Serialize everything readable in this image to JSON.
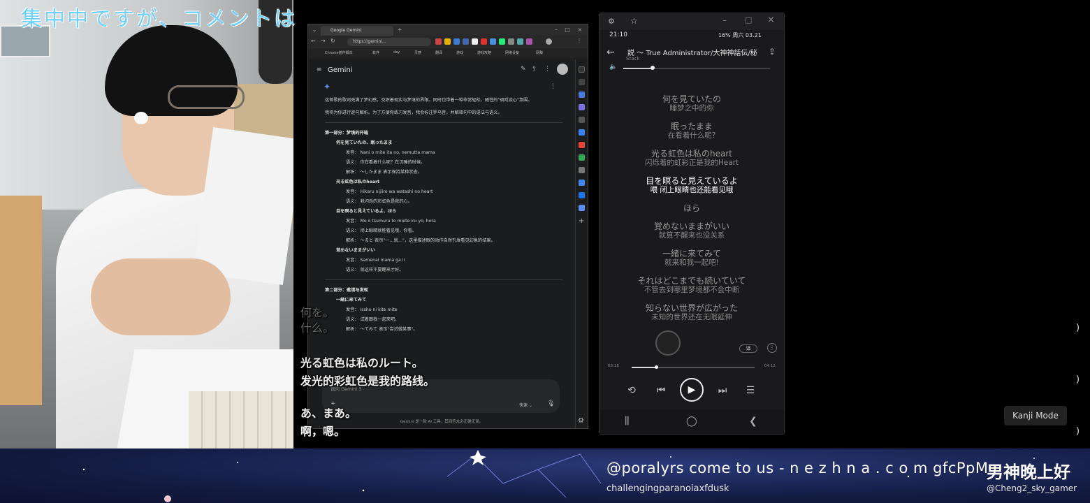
{
  "stream": {
    "title_overlay": "集中中ですが、コメントは",
    "overlay_lines": [
      {
        "text": "何を。",
        "style": "dim"
      },
      {
        "text": "什么。",
        "style": "dim"
      },
      {
        "text": "光る虹色は私のルート。",
        "style": "br"
      },
      {
        "text": "发光的彩虹色是我的路线。",
        "style": "br"
      },
      {
        "text": "あ、まあ。",
        "style": "br"
      },
      {
        "text": "啊，嗯。",
        "style": "br"
      }
    ],
    "ticker": "@poralyrs come to us - n e z h n a . c o m gfcPpM",
    "ticker_sub": "challengingparanoiaxfdusk",
    "greeting": "男神晚上好",
    "handle": "@Cheng2_sky_gamer",
    "kanji_mode": "Kanji Mode"
  },
  "browser": {
    "tab_title": "Google Gemini",
    "url": "https://gemini...",
    "bookmarks": [
      "Chrome插件脚本",
      "软件",
      "day",
      "灵感",
      "翻译",
      "游戏",
      "游戏攻略",
      "网络设备",
      "网赚"
    ],
    "app_title": "Gemini",
    "content": {
      "intro": "这首歌的歌词充满了梦幻感，交织着现实与梦境的界限。同时也带着一种非常轻松、随性的\"调戏谈心\"氛围。",
      "intro2": "我将为你进行逐句解析。为了方便你练习发音，我会标注罗马音，并解释句中的语法与语义。",
      "section1": "第一部分：梦境的开端",
      "items1": [
        {
          "head": "何を見ていたの、眠ったまま",
          "lines": [
            "发音： Nani o mite ita no, nemutta mama",
            "语义： 你在看着什么呢？在沉睡的时候。",
            "解析： 〜したまま 表示保持某种状态。"
          ]
        },
        {
          "head": "光る虹色は私のheart",
          "lines": [
            "发音： Hikaru nijiiro wa watashi no heart",
            "语义： 我闪烁的彩虹色是我的心。"
          ]
        },
        {
          "head": "目を瞑ると見えているよ、ほら",
          "lines": [
            "发音： Me o tsumuru to miete iru yo, hora",
            "语义： 闭上眼睛就能看见哦，你看。",
            "解析： 〜ると 表示\"一…就…\"，这里描述眼的动作自然引发看见幻象的结果。"
          ]
        },
        {
          "head": "覚めないままがいい",
          "lines": [
            "发音： Samenai mama ga ii",
            "语义： 就这样不要醒来才好。"
          ]
        }
      ],
      "section2": "第二部分：邀请与发现",
      "items2": [
        {
          "head": "一緒に来てみて",
          "lines": [
            "发音： Issho ni kite mite",
            "语义： 试着跟我一起来吧。",
            "解析： 〜てみて 表示\"尝试做某事\"。"
          ]
        }
      ]
    },
    "chat_placeholder": "询问 Gemini 3",
    "chat_mode": "快速",
    "disclaimer": "Gemini 是一款 AI 工具，其回答未必正确无误。"
  },
  "player": {
    "status_time": "21:10",
    "status_right": "16%  周六 03.21",
    "title": "説 ～ True Administrator/大神神話伝/秘",
    "artist": "Stack",
    "volume": 0.2,
    "lyrics": [
      {
        "jp": "何を見ていたの",
        "cn": "睡梦之中的你",
        "current": false
      },
      {
        "jp": "眠ったまま",
        "cn": "在看着什么呢?",
        "current": false
      },
      {
        "jp": "光る虹色は私のheart",
        "cn": "闪烁着的虹彩正是我的Heart",
        "current": false
      },
      {
        "jp": "目を瞑ると見えているよ",
        "cn": "喂 闭上眼睛也还能看见哦",
        "current": true
      },
      {
        "jp": "ほら",
        "cn": "",
        "current": false
      },
      {
        "jp": "覚めないままがいい",
        "cn": "就算不醒来也没关系",
        "current": false
      },
      {
        "jp": "一緒に来てみて",
        "cn": "就来和我一起吧!",
        "current": false
      },
      {
        "jp": "それはどこまでも続いていて",
        "cn": "不管去到哪里梦境都不会中断",
        "current": false
      },
      {
        "jp": "知らない世界が広がった",
        "cn": "未知的世界还在无限延伸",
        "current": false
      }
    ],
    "time_elapsed": "08:18",
    "time_total": "04:12",
    "progress": 0.2,
    "translate_label": "译"
  }
}
